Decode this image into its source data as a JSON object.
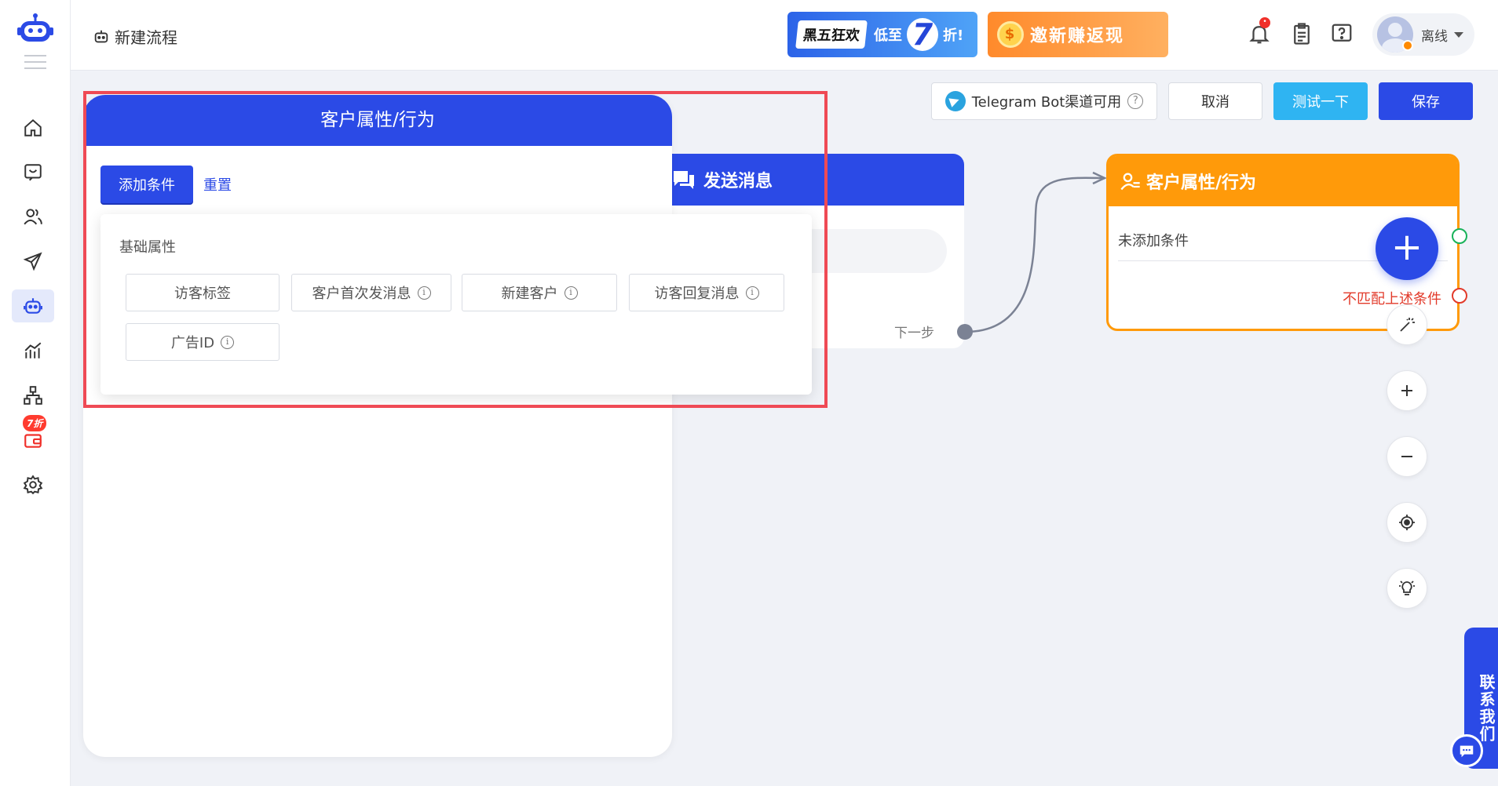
{
  "colors": {
    "primary": "#2b4ae6",
    "accent_orange": "#ff9a0a",
    "test_button": "#2fb4f2",
    "danger": "#e23a2a",
    "highlight": "#ef4a55"
  },
  "sidebar": {
    "items": [
      {
        "icon": "home-icon"
      },
      {
        "icon": "chat-icon"
      },
      {
        "icon": "users-icon"
      },
      {
        "icon": "send-icon"
      },
      {
        "icon": "robot-icon",
        "active": true
      },
      {
        "icon": "analytics-icon"
      },
      {
        "icon": "org-chart-icon"
      },
      {
        "icon": "wallet-icon",
        "badge": "7折"
      },
      {
        "icon": "gear-icon"
      }
    ]
  },
  "header": {
    "breadcrumb": "新建流程",
    "promo_blackfriday": {
      "tag": "黑五狂欢",
      "mid": "低至",
      "big": "7",
      "suffix": "折!"
    },
    "promo_invite": {
      "text": "邀新赚返现"
    },
    "notification_dot": "•",
    "user": {
      "name": "离线"
    }
  },
  "toolbar": {
    "telegram": "Telegram Bot渠道可用",
    "help": "?",
    "cancel": "取消",
    "test": "测试一下",
    "save": "保存"
  },
  "node_send": {
    "title": "发送消息",
    "next": "下一步"
  },
  "node_attr": {
    "title": "客户属性/行为",
    "no_condition": "未添加条件",
    "unmatched": "不匹配上述条件"
  },
  "fab": {
    "label": "+"
  },
  "tools": [
    "magic-wand-icon",
    "zoom-in-icon",
    "zoom-out-icon",
    "locate-icon",
    "lightbulb-icon"
  ],
  "panel": {
    "title": "客户属性/行为",
    "add_condition": "添加条件",
    "reset": "重置",
    "dropdown": {
      "section": "基础属性",
      "options": [
        {
          "label": "访客标签",
          "info": false
        },
        {
          "label": "客户首次发消息",
          "info": true
        },
        {
          "label": "新建客户",
          "info": true
        },
        {
          "label": "访客回复消息",
          "info": true
        },
        {
          "label": "广告ID",
          "info": true
        }
      ],
      "info_glyph": "i"
    }
  },
  "contact": {
    "label": "联系我们"
  }
}
